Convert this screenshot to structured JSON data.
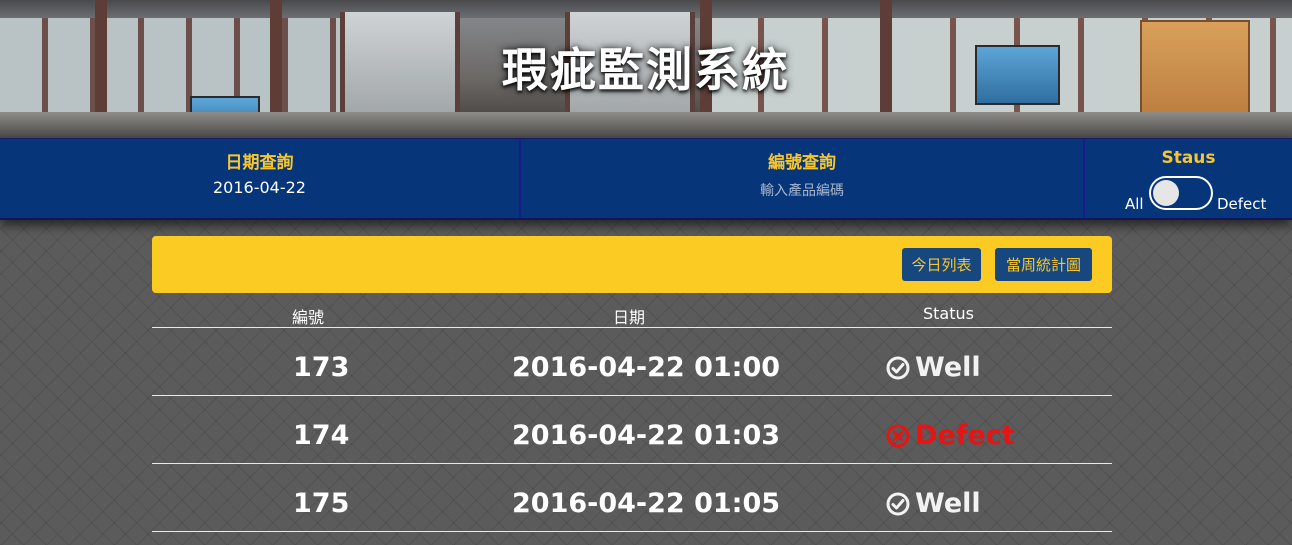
{
  "header": {
    "title": "瑕疵監測系統"
  },
  "filters": {
    "date": {
      "label": "日期查詢",
      "value": "2016-04-22"
    },
    "id": {
      "label": "編號查詢",
      "placeholder": "輸入產品編碼"
    },
    "status": {
      "label": "Staus",
      "left_label": "All",
      "right_label": "Defect",
      "toggle_on": false
    }
  },
  "toolbar": {
    "today_list": "今日列表",
    "weekly_chart": "當周統計圖"
  },
  "table": {
    "columns": [
      "編號",
      "日期",
      "Status"
    ],
    "rows": [
      {
        "id": "173",
        "date": "2016-04-22 01:00",
        "status": "Well",
        "status_icon": "check-circle-icon"
      },
      {
        "id": "174",
        "date": "2016-04-22 01:03",
        "status": "Defect",
        "status_icon": "x-circle-icon"
      },
      {
        "id": "175",
        "date": "2016-04-22 01:05",
        "status": "Well",
        "status_icon": "check-circle-icon"
      }
    ]
  },
  "colors": {
    "filter_bar": "#063579",
    "accent_yellow": "#fbca23",
    "button_blue": "#17477f",
    "defect_red": "#e61414"
  }
}
